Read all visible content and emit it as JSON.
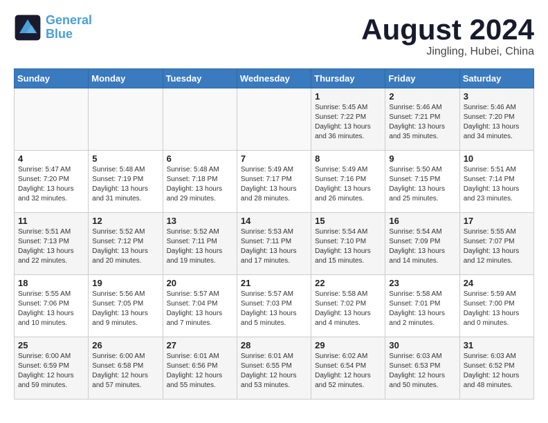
{
  "logo": {
    "line1": "General",
    "line2": "Blue"
  },
  "title": "August 2024",
  "subtitle": "Jingling, Hubei, China",
  "days_of_week": [
    "Sunday",
    "Monday",
    "Tuesday",
    "Wednesday",
    "Thursday",
    "Friday",
    "Saturday"
  ],
  "weeks": [
    [
      {
        "day": "",
        "info": ""
      },
      {
        "day": "",
        "info": ""
      },
      {
        "day": "",
        "info": ""
      },
      {
        "day": "",
        "info": ""
      },
      {
        "day": "1",
        "info": "Sunrise: 5:45 AM\nSunset: 7:22 PM\nDaylight: 13 hours\nand 36 minutes."
      },
      {
        "day": "2",
        "info": "Sunrise: 5:46 AM\nSunset: 7:21 PM\nDaylight: 13 hours\nand 35 minutes."
      },
      {
        "day": "3",
        "info": "Sunrise: 5:46 AM\nSunset: 7:20 PM\nDaylight: 13 hours\nand 34 minutes."
      }
    ],
    [
      {
        "day": "4",
        "info": "Sunrise: 5:47 AM\nSunset: 7:20 PM\nDaylight: 13 hours\nand 32 minutes."
      },
      {
        "day": "5",
        "info": "Sunrise: 5:48 AM\nSunset: 7:19 PM\nDaylight: 13 hours\nand 31 minutes."
      },
      {
        "day": "6",
        "info": "Sunrise: 5:48 AM\nSunset: 7:18 PM\nDaylight: 13 hours\nand 29 minutes."
      },
      {
        "day": "7",
        "info": "Sunrise: 5:49 AM\nSunset: 7:17 PM\nDaylight: 13 hours\nand 28 minutes."
      },
      {
        "day": "8",
        "info": "Sunrise: 5:49 AM\nSunset: 7:16 PM\nDaylight: 13 hours\nand 26 minutes."
      },
      {
        "day": "9",
        "info": "Sunrise: 5:50 AM\nSunset: 7:15 PM\nDaylight: 13 hours\nand 25 minutes."
      },
      {
        "day": "10",
        "info": "Sunrise: 5:51 AM\nSunset: 7:14 PM\nDaylight: 13 hours\nand 23 minutes."
      }
    ],
    [
      {
        "day": "11",
        "info": "Sunrise: 5:51 AM\nSunset: 7:13 PM\nDaylight: 13 hours\nand 22 minutes."
      },
      {
        "day": "12",
        "info": "Sunrise: 5:52 AM\nSunset: 7:12 PM\nDaylight: 13 hours\nand 20 minutes."
      },
      {
        "day": "13",
        "info": "Sunrise: 5:52 AM\nSunset: 7:11 PM\nDaylight: 13 hours\nand 19 minutes."
      },
      {
        "day": "14",
        "info": "Sunrise: 5:53 AM\nSunset: 7:11 PM\nDaylight: 13 hours\nand 17 minutes."
      },
      {
        "day": "15",
        "info": "Sunrise: 5:54 AM\nSunset: 7:10 PM\nDaylight: 13 hours\nand 15 minutes."
      },
      {
        "day": "16",
        "info": "Sunrise: 5:54 AM\nSunset: 7:09 PM\nDaylight: 13 hours\nand 14 minutes."
      },
      {
        "day": "17",
        "info": "Sunrise: 5:55 AM\nSunset: 7:07 PM\nDaylight: 13 hours\nand 12 minutes."
      }
    ],
    [
      {
        "day": "18",
        "info": "Sunrise: 5:55 AM\nSunset: 7:06 PM\nDaylight: 13 hours\nand 10 minutes."
      },
      {
        "day": "19",
        "info": "Sunrise: 5:56 AM\nSunset: 7:05 PM\nDaylight: 13 hours\nand 9 minutes."
      },
      {
        "day": "20",
        "info": "Sunrise: 5:57 AM\nSunset: 7:04 PM\nDaylight: 13 hours\nand 7 minutes."
      },
      {
        "day": "21",
        "info": "Sunrise: 5:57 AM\nSunset: 7:03 PM\nDaylight: 13 hours\nand 5 minutes."
      },
      {
        "day": "22",
        "info": "Sunrise: 5:58 AM\nSunset: 7:02 PM\nDaylight: 13 hours\nand 4 minutes."
      },
      {
        "day": "23",
        "info": "Sunrise: 5:58 AM\nSunset: 7:01 PM\nDaylight: 13 hours\nand 2 minutes."
      },
      {
        "day": "24",
        "info": "Sunrise: 5:59 AM\nSunset: 7:00 PM\nDaylight: 13 hours\nand 0 minutes."
      }
    ],
    [
      {
        "day": "25",
        "info": "Sunrise: 6:00 AM\nSunset: 6:59 PM\nDaylight: 12 hours\nand 59 minutes."
      },
      {
        "day": "26",
        "info": "Sunrise: 6:00 AM\nSunset: 6:58 PM\nDaylight: 12 hours\nand 57 minutes."
      },
      {
        "day": "27",
        "info": "Sunrise: 6:01 AM\nSunset: 6:56 PM\nDaylight: 12 hours\nand 55 minutes."
      },
      {
        "day": "28",
        "info": "Sunrise: 6:01 AM\nSunset: 6:55 PM\nDaylight: 12 hours\nand 53 minutes."
      },
      {
        "day": "29",
        "info": "Sunrise: 6:02 AM\nSunset: 6:54 PM\nDaylight: 12 hours\nand 52 minutes."
      },
      {
        "day": "30",
        "info": "Sunrise: 6:03 AM\nSunset: 6:53 PM\nDaylight: 12 hours\nand 50 minutes."
      },
      {
        "day": "31",
        "info": "Sunrise: 6:03 AM\nSunset: 6:52 PM\nDaylight: 12 hours\nand 48 minutes."
      }
    ]
  ]
}
